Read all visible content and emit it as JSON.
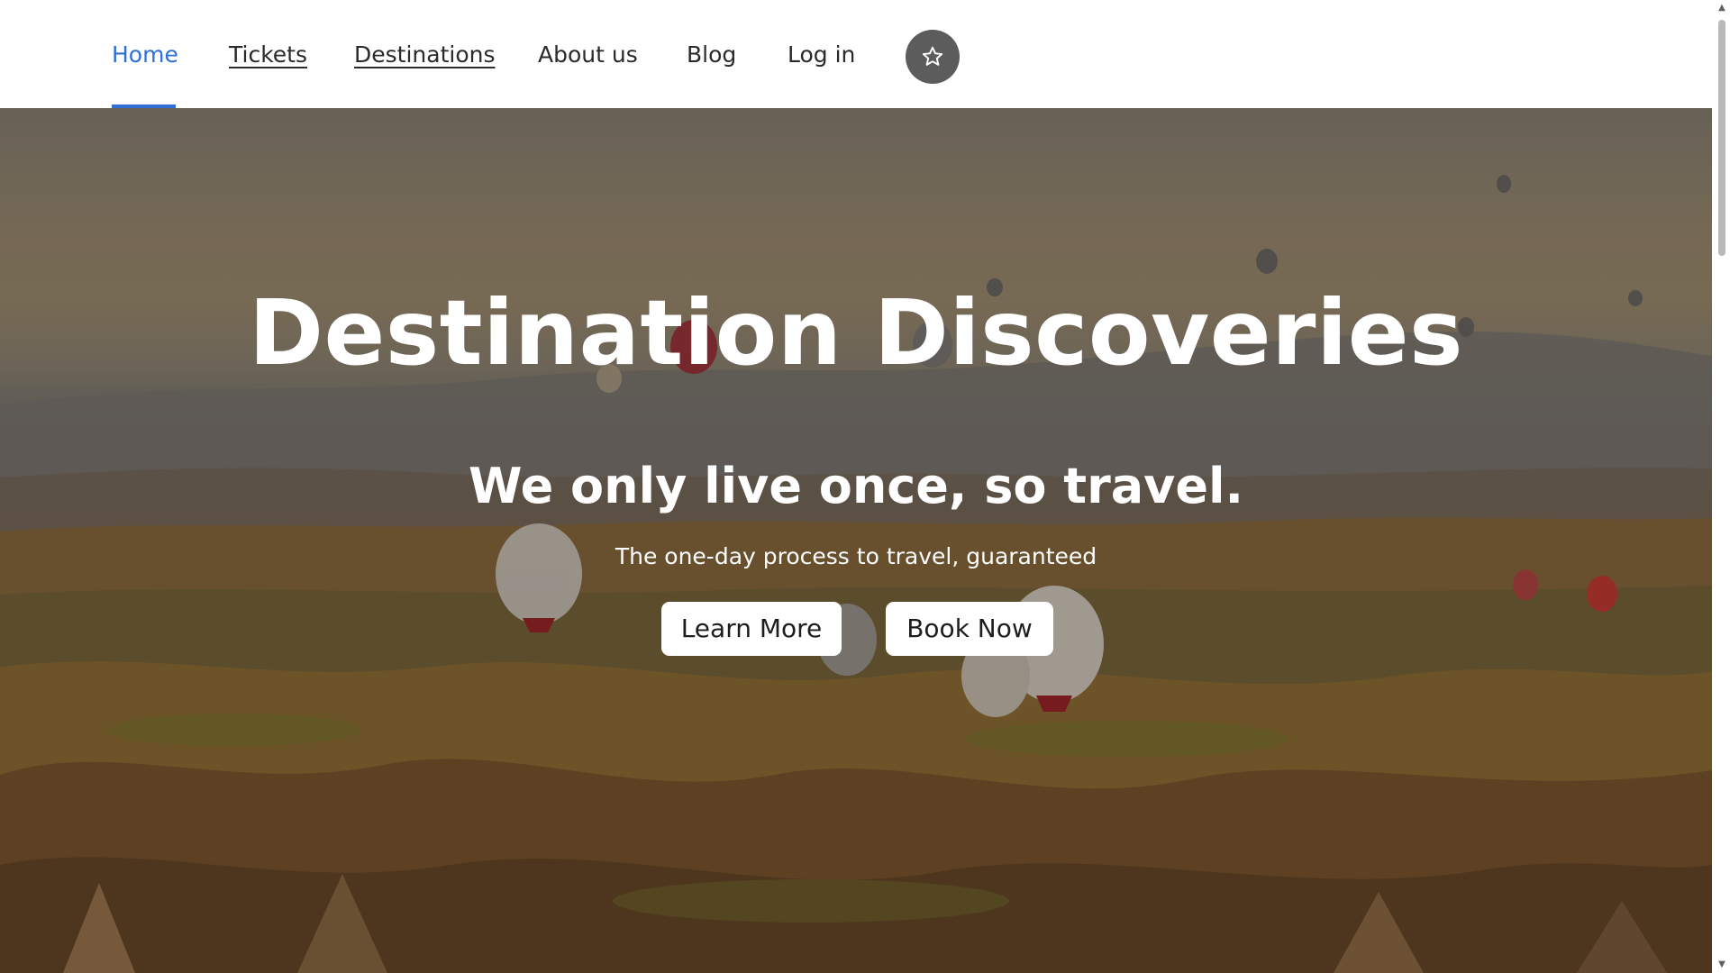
{
  "nav": {
    "items": [
      {
        "label": "Home",
        "active": true,
        "underlined": false
      },
      {
        "label": "Tickets",
        "active": false,
        "underlined": true
      },
      {
        "label": "Destinations",
        "active": false,
        "underlined": true
      },
      {
        "label": "About us",
        "active": false,
        "underlined": false
      },
      {
        "label": "Blog",
        "active": false,
        "underlined": false
      },
      {
        "label": "Log in",
        "active": false,
        "underlined": false
      }
    ],
    "favorite_icon": "star-icon"
  },
  "hero": {
    "title": "Destination Discoveries",
    "subtitle": "We only live once, so travel.",
    "tagline": "The one-day process to travel, guaranteed",
    "buttons": {
      "learn_more": "Learn More",
      "book_now": "Book Now"
    }
  },
  "colors": {
    "accent": "#2f6fd6",
    "nav_text": "#2a2a2a",
    "star_button_bg": "#5c5c5c",
    "hero_text": "#ffffff",
    "button_bg": "#ffffff"
  }
}
